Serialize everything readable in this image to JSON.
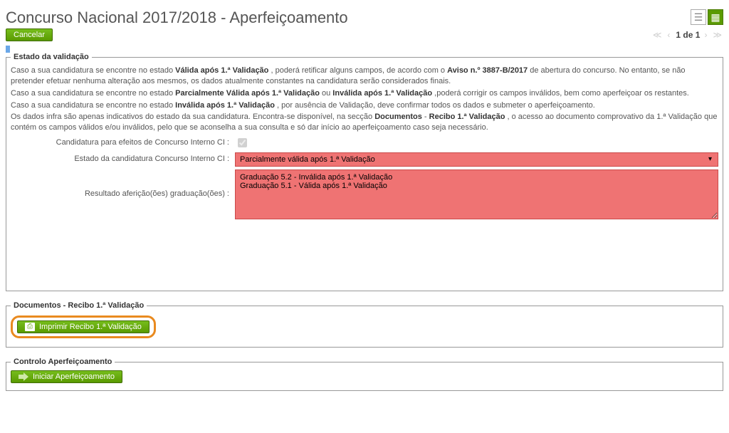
{
  "header": {
    "title": "Concurso Nacional 2017/2018 - Aperfeiçoamento"
  },
  "actions": {
    "cancel": "Cancelar",
    "print_receipt": "Imprimir Recibo 1.ª Validação",
    "start_improvement": "Iniciar Aperfeiçoamento"
  },
  "pager": {
    "text": "1 de 1"
  },
  "validation": {
    "legend": "Estado da validação",
    "p1_a": "Caso a sua candidatura se encontre no estado ",
    "p1_b": "Válida após 1.ª Validação",
    "p1_c": " , poderá retificar alguns campos, de acordo com o ",
    "p1_d": "Aviso n.º 3887-B/2017",
    "p1_e": " de abertura do concurso. No entanto, se não pretender efetuar nenhuma alteração aos mesmos, os dados atualmente constantes na candidatura serão considerados finais.",
    "p2_a": "Caso a sua candidatura se encontre no estado ",
    "p2_b": "Parcialmente Válida após 1.ª Validação",
    "p2_c": " ou ",
    "p2_d": "Inválida após 1.ª Validação",
    "p2_e": ",poderá corrigir os campos inválidos, bem como aperfeiçoar os restantes.",
    "p3_a": "Caso a sua candidatura se encontre no estado ",
    "p3_b": "Inválida após 1.ª Validação",
    "p3_c": " , por ausência de Validação, deve confirmar todos os dados e submeter o aperfeiçoamento.",
    "p4_a": "Os dados infra são apenas indicativos do estado da sua candidatura. Encontra-se disponível, na secção ",
    "p4_b": "Documentos",
    "p4_c": " - ",
    "p4_d": "Recibo 1.ª Validação",
    "p4_e": ", o acesso ao documento comprovativo da 1.ª Validação que contém os campos válidos e/ou inválidos, pelo que se aconselha a sua consulta e só dar início ao aperfeiçoamento caso seja necessário.",
    "row_ci_label": "Candidatura para efeitos de Concurso Interno CI :",
    "row_estado_label": "Estado da candidatura Concurso Interno CI :",
    "row_estado_value": "Parcialmente válida após 1.ª Validação",
    "row_resultado_label": "Resultado aferição(ões) graduação(ões) :",
    "row_resultado_value": "Graduação 5.2 - Inválida após 1.ª Validação\nGraduação 5.1 - Válida após 1.ª Validação"
  },
  "docs": {
    "legend": "Documentos - Recibo 1.ª Validação"
  },
  "controlo": {
    "legend": "Controlo Aperfeiçoamento"
  }
}
